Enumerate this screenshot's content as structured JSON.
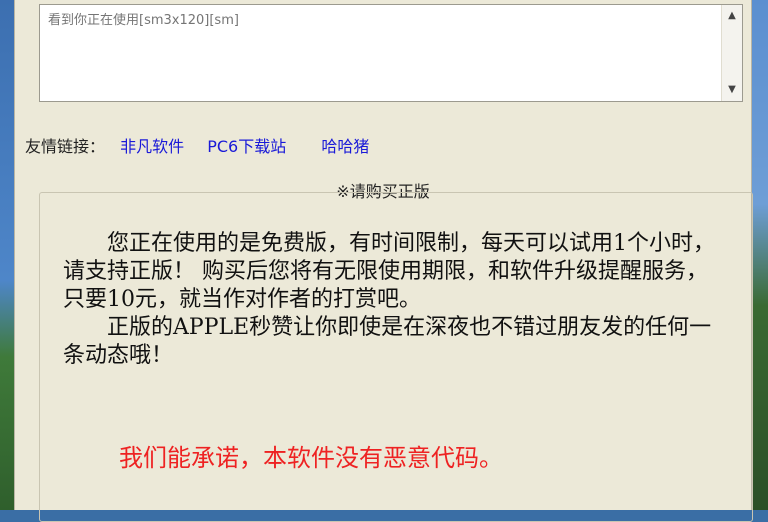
{
  "note_box": {
    "placeholder": "看到你正在使用[sm3x120][sm]"
  },
  "links": {
    "label": "友情链接：",
    "items": [
      "非凡软件",
      "PC6下载站",
      "哈哈猪"
    ]
  },
  "purchase": {
    "title": "※请购买正版",
    "paragraph1": "您正在使用的是免费版，有时间限制，每天可以试用1个小时，请支持正版！ 购买后您将有无限使用期限，和软件升级提醒服务，只要10元，就当作对作者的打赏吧。",
    "paragraph2": "正版的APPLE秒赞让你即使是在深夜也不错过朋友发的任何一条动态哦！",
    "promise": "我们能承诺，本软件没有恶意代码。"
  },
  "colors": {
    "link": "#1a1ad8",
    "promise": "#ee2222",
    "window_bg": "#ece9d8"
  }
}
